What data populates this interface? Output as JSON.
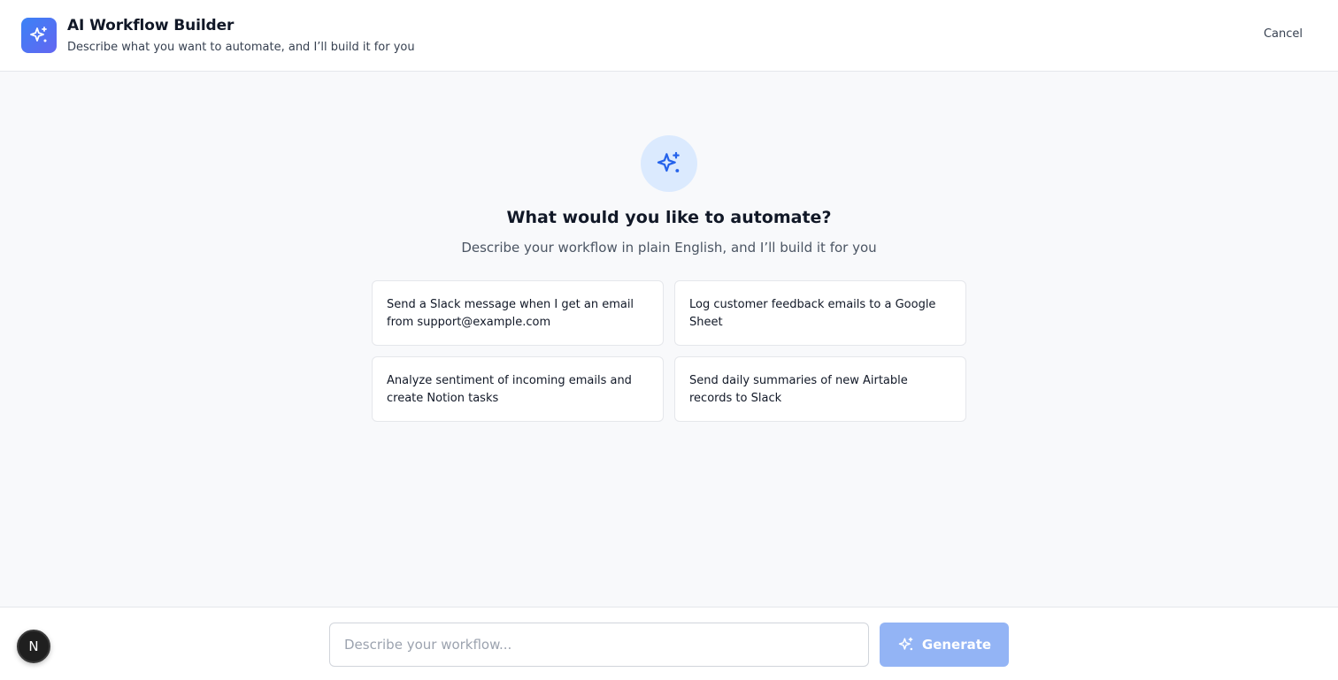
{
  "header": {
    "title": "AI Workflow Builder",
    "subtitle": "Describe what you want to automate, and I’ll build it for you",
    "cancel_label": "Cancel",
    "logo_icon": "sparkles-icon"
  },
  "hero": {
    "icon": "sparkles-icon",
    "title": "What would you like to automate?",
    "subtitle": "Describe your workflow in plain English, and I’ll build it for you"
  },
  "suggestions": [
    {
      "label": "Send a Slack message when I get an email from support@example.com"
    },
    {
      "label": "Log customer feedback emails to a Google Sheet"
    },
    {
      "label": "Analyze sentiment of incoming emails and create Notion tasks"
    },
    {
      "label": "Send daily summaries of new Airtable records to Slack"
    }
  ],
  "composer": {
    "placeholder": "Describe your workflow...",
    "value": "",
    "generate_label": "Generate",
    "generate_icon": "sparkles-icon"
  },
  "badge": {
    "letter": "N"
  },
  "colors": {
    "accent": "#3b82f6",
    "accent_light": "#dbeafe",
    "generate_disabled": "#93b4f5",
    "background": "#f8f9fb"
  }
}
